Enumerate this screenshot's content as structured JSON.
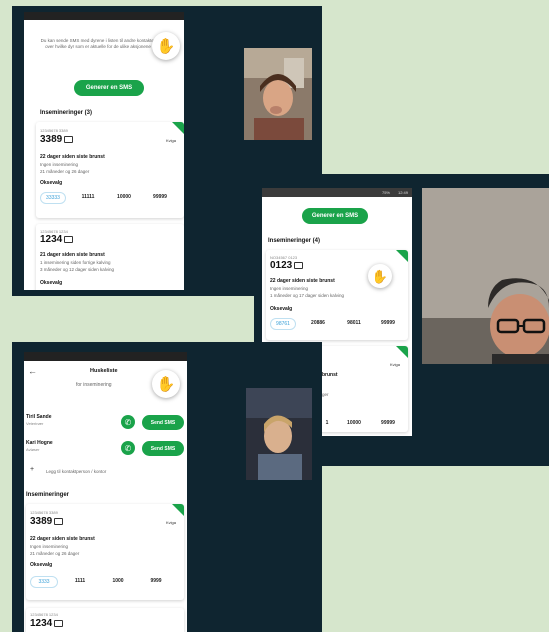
{
  "hand_icon": "raised-hand-icon",
  "colors": {
    "green": "#1aa34a",
    "window": "#0f2530",
    "hand": "#f2b01e",
    "selected": "#3aa0d8"
  },
  "window1": {
    "sms_note": "Du kan sende SMS med dyrene i listen til andre kontakter over hvilke dyr som er aktuelle for de ulike aksjonene",
    "sms_button": "Generer en SMS",
    "section_title": "Insemineringer (3)",
    "cards": [
      {
        "id_small": "12345678 3389",
        "id_big": "3389",
        "badge": "Kviga",
        "days": "22 dager siden siste brunst",
        "line1": "Ingen inseminering",
        "line2": "21 måneder og 26 dager",
        "okse_label": "Oksevalg",
        "bulls": [
          "33333",
          "11111",
          "10000",
          "99999"
        ]
      },
      {
        "id_small": "12345678 1234",
        "id_big": "1234",
        "days": "21 dager siden siste brunst",
        "line1": "1 inseminering siden forrige kalving",
        "line2": "3 måneder og 12 dager siden kalving",
        "next": "Oksevalg"
      }
    ]
  },
  "window2": {
    "status_time": "12:49",
    "status_batt": "75%",
    "sms_button": "Generer en SMS",
    "section_title": "Insemineringer (4)",
    "cards": [
      {
        "id_small": "NO34567 0123",
        "id_big": "0123",
        "days": "22 dager siden siste brunst",
        "line1": "Ingen inseminering",
        "line2": "1 måneder og 17 dager siden kalving",
        "okse_label": "Oksevalg",
        "bulls": [
          "98761",
          "20886",
          "98011",
          "99999"
        ]
      },
      {
        "badge": "Kviga",
        "days": "brunst",
        "line1": "ger",
        "bulls": [
          "1",
          "10000",
          "99999"
        ]
      }
    ]
  },
  "window3": {
    "back_icon": "arrow-left-icon",
    "title": "Huskeliste",
    "subtitle": "for inseminering",
    "contacts": [
      {
        "name": "Tiril Sande",
        "role": "Veterinær",
        "button": "Send SMS"
      },
      {
        "name": "Kari Hogne",
        "role": "Avløser",
        "button": "Send SMS"
      }
    ],
    "add_contact": "Legg til kontaktperson / kontor",
    "section_title": "Insemineringer",
    "cards": [
      {
        "id_small": "12345678 3389",
        "id_big": "3389",
        "badge": "Kviga",
        "days": "22 dager siden siste brunst",
        "line1": "Ingen inseminering",
        "line2": "21 måneder og 26 dager",
        "okse_label": "Oksevalg",
        "bulls": [
          "3333",
          "1111",
          "1000",
          "9999"
        ]
      },
      {
        "id_small": "12345678 1234",
        "id_big": "1234"
      }
    ]
  }
}
